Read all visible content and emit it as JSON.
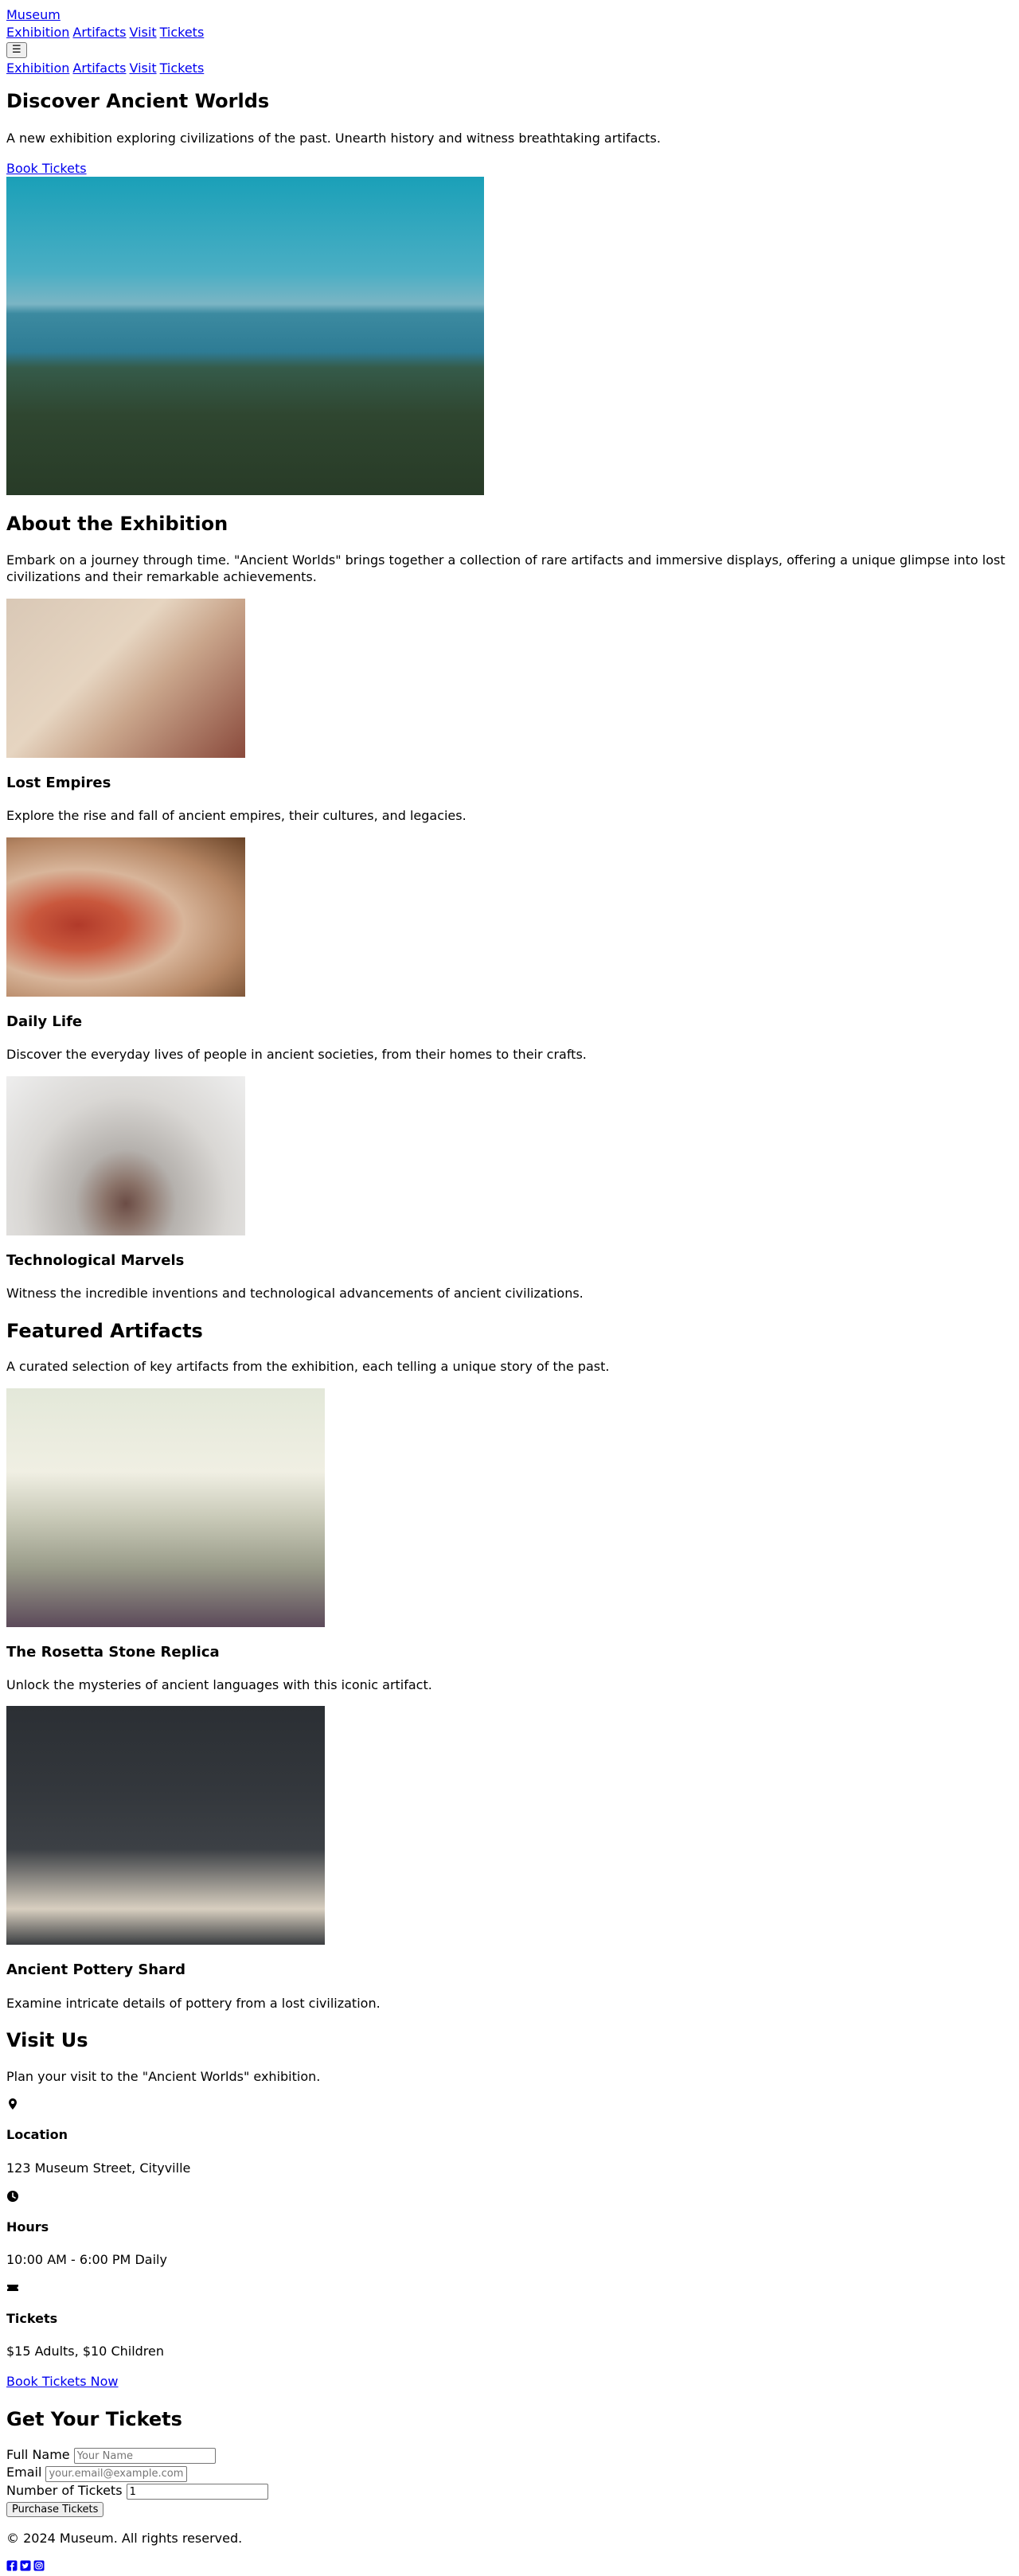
{
  "header": {
    "logo": "Museum",
    "nav": [
      "Exhibition",
      "Artifacts",
      "Visit",
      "Tickets"
    ],
    "menu_button": "☰",
    "mobile_nav": [
      "Exhibition",
      "Artifacts",
      "Visit",
      "Tickets"
    ]
  },
  "hero": {
    "title": "Discover Ancient Worlds",
    "subtitle": "A new exhibition exploring civilizations of the past. Unearth history and witness breathtaking artifacts.",
    "cta": "Book Tickets"
  },
  "about": {
    "title": "About the Exhibition",
    "text": "Embark on a journey through time. \"Ancient Worlds\" brings together a collection of rare artifacts and immersive displays, offering a unique glimpse into lost civilizations and their remarkable achievements.",
    "cards": [
      {
        "title": "Lost Empires",
        "text": "Explore the rise and fall of ancient empires, their cultures, and legacies."
      },
      {
        "title": "Daily Life",
        "text": "Discover the everyday lives of people in ancient societies, from their homes to their crafts."
      },
      {
        "title": "Technological Marvels",
        "text": "Witness the incredible inventions and technological advancements of ancient civilizations."
      }
    ]
  },
  "artifacts": {
    "title": "Featured Artifacts",
    "intro": "A curated selection of key artifacts from the exhibition, each telling a unique story of the past.",
    "items": [
      {
        "title": "The Rosetta Stone Replica",
        "text": "Unlock the mysteries of ancient languages with this iconic artifact."
      },
      {
        "title": "Ancient Pottery Shard",
        "text": "Examine intricate details of pottery from a lost civilization."
      }
    ]
  },
  "visit": {
    "title": "Visit Us",
    "intro": "Plan your visit to the \"Ancient Worlds\" exhibition.",
    "info": [
      {
        "icon": "map-pin-icon",
        "title": "Location",
        "text": "123 Museum Street, Cityville"
      },
      {
        "icon": "clock-icon",
        "title": "Hours",
        "text": "10:00 AM - 6:00 PM Daily"
      },
      {
        "icon": "ticket-icon",
        "title": "Tickets",
        "text": "$15 Adults, $10 Children"
      }
    ],
    "cta": "Book Tickets Now"
  },
  "tickets": {
    "title": "Get Your Tickets",
    "name_label": "Full Name",
    "name_placeholder": "Your Name",
    "email_label": "Email",
    "email_placeholder": "your.email@example.com",
    "count_label": "Number of Tickets",
    "count_value": "1",
    "submit": "Purchase Tickets"
  },
  "footer": {
    "copyright": "© 2024 Museum. All rights reserved.",
    "social": [
      "facebook-icon",
      "twitter-icon",
      "instagram-icon"
    ],
    "link_color": "#0000ee"
  }
}
